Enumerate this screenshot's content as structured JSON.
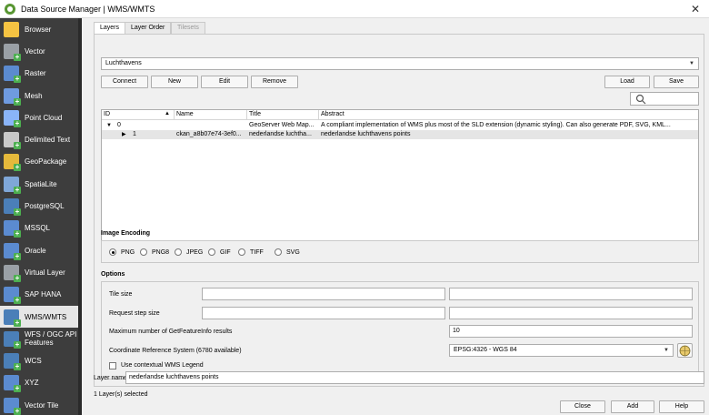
{
  "window": {
    "title": "Data Source Manager | WMS/WMTS",
    "close": "✕"
  },
  "sidebar": {
    "items": [
      {
        "label": "Browser",
        "icon": "folder-icon",
        "color": "#f5c342"
      },
      {
        "label": "Vector",
        "icon": "vector-icon",
        "color": "#9aa0a6"
      },
      {
        "label": "Raster",
        "icon": "raster-icon",
        "color": "#5b8bd0"
      },
      {
        "label": "Mesh",
        "icon": "mesh-icon",
        "color": "#6f9be0"
      },
      {
        "label": "Point Cloud",
        "icon": "point-cloud-icon",
        "color": "#8ab4f8"
      },
      {
        "label": "Delimited Text",
        "icon": "delimited-text-icon",
        "color": "#c8c8c8"
      },
      {
        "label": "GeoPackage",
        "icon": "geopackage-icon",
        "color": "#e5b93b"
      },
      {
        "label": "SpatiaLite",
        "icon": "spatialite-icon",
        "color": "#7fa7d8"
      },
      {
        "label": "PostgreSQL",
        "icon": "postgresql-icon",
        "color": "#4b7fb8"
      },
      {
        "label": "MSSQL",
        "icon": "mssql-icon",
        "color": "#5b8bd0"
      },
      {
        "label": "Oracle",
        "icon": "oracle-icon",
        "color": "#5b8bd0"
      },
      {
        "label": "Virtual Layer",
        "icon": "virtual-layer-icon",
        "color": "#9aa0a6"
      },
      {
        "label": "SAP HANA",
        "icon": "sap-hana-icon",
        "color": "#5b8bd0"
      },
      {
        "label": "WMS/WMTS",
        "icon": "wms-icon",
        "color": "#4b7fb8",
        "selected": true
      },
      {
        "label": "WFS / OGC API - Features",
        "icon": "wfs-icon",
        "color": "#4b7fb8"
      },
      {
        "label": "WCS",
        "icon": "wcs-icon",
        "color": "#4b7fb8"
      },
      {
        "label": "XYZ",
        "icon": "xyz-icon",
        "color": "#5b8bd0"
      },
      {
        "label": "Vector Tile",
        "icon": "vector-tile-icon",
        "color": "#5b8bd0"
      }
    ]
  },
  "tabs": [
    "Layers",
    "Layer Order",
    "Tilesets"
  ],
  "connection": {
    "selected": "Luchthavens"
  },
  "buttons": {
    "connect": "Connect",
    "new": "New",
    "edit": "Edit",
    "remove": "Remove",
    "load": "Load",
    "save": "Save"
  },
  "tree": {
    "headers": [
      "ID",
      "Name",
      "Title",
      "Abstract"
    ],
    "rows": [
      {
        "id": "0",
        "name": "",
        "title": "GeoServer Web Map...",
        "abstract": "A compliant implementation of WMS plus most of the SLD extension (dynamic styling). Can also generate PDF, SVG, KML..."
      },
      {
        "id": "1",
        "name": "ckan_a8b07e74-3ef0...",
        "title": "nederlandse luchtha...",
        "abstract": "nederlandse luchthavens points"
      }
    ]
  },
  "image_encoding": {
    "title": "Image Encoding",
    "options": [
      "PNG",
      "PNG8",
      "JPEG",
      "GIF",
      "TIFF",
      "SVG"
    ],
    "selected": "PNG"
  },
  "options": {
    "title": "Options",
    "tile_size": "Tile size",
    "request_step": "Request step size",
    "max_features": "Maximum number of GetFeatureInfo results",
    "max_features_value": "10",
    "crs_label": "Coordinate Reference System (6780 available)",
    "crs_value": "EPSG:4326 - WGS 84",
    "contextual_legend": "Use contextual WMS Legend"
  },
  "layer_name": {
    "label": "Layer name",
    "value": "nederlandse luchthavens points"
  },
  "status": "1 Layer(s) selected",
  "footer": {
    "close": "Close",
    "add": "Add",
    "help": "Help"
  }
}
